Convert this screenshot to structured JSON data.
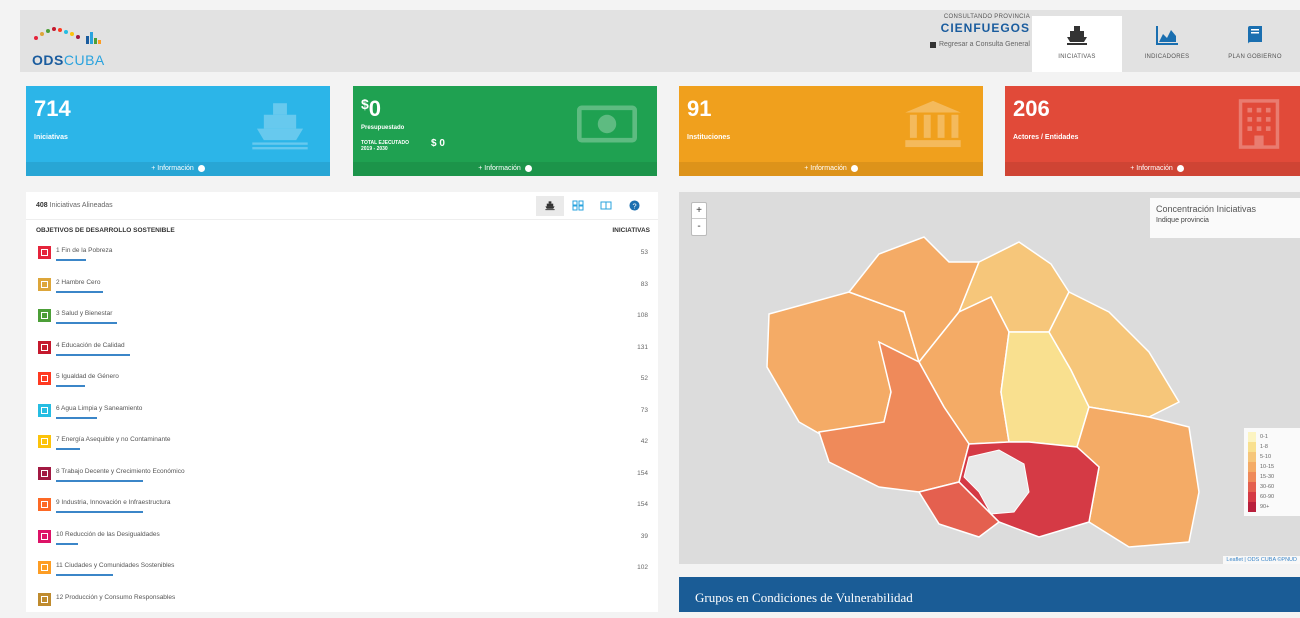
{
  "header": {
    "logo_ods": "ODS",
    "logo_cuba": "CUBA",
    "province_caption": "CONSULTANDO PROVINCIA",
    "province_name": "CIENFUEGOS",
    "province_link": "Regresar a Consulta General",
    "nav": [
      {
        "label": "INICIATIVAS",
        "icon": "ship-icon",
        "active": true
      },
      {
        "label": "INDICADORES",
        "icon": "area-chart-icon",
        "active": false
      },
      {
        "label": "PLAN GOBIERNO",
        "icon": "book-icon",
        "active": false
      }
    ]
  },
  "cards": [
    {
      "value": "714",
      "label": "Iniciativas",
      "more": "+ Información",
      "color": "#2cb5e8",
      "icon": "ship-icon"
    },
    {
      "value": "0",
      "currency": "$",
      "label": "Presupuestado",
      "sub_label_1": "TOTAL EJECUTADO",
      "sub_label_2": "2019 - 2030",
      "sub_value": "$ 0",
      "more": "+ Información",
      "color": "#1fa151",
      "icon": "money-icon"
    },
    {
      "value": "91",
      "label": "Instituciones",
      "more": "+ Información",
      "color": "#f0a01d",
      "icon": "institution-icon"
    },
    {
      "value": "206",
      "label": "Actores / Entidades",
      "more": "+ Información",
      "color": "#e14a39",
      "icon": "building-icon"
    }
  ],
  "ods_panel": {
    "count_number": "408",
    "count_text": "Iniciativas Alineadas",
    "col_objectives": "OBJETIVOS DE DESARROLLO SOSTENIBLE",
    "col_initiatives": "INICIATIVAS",
    "rows": [
      {
        "name": "1 Fin de la Pobreza",
        "value": "53",
        "color": "#e5243b"
      },
      {
        "name": "2 Hambre Cero",
        "value": "83",
        "color": "#dda63a"
      },
      {
        "name": "3 Salud y Bienestar",
        "value": "108",
        "color": "#4c9f38"
      },
      {
        "name": "4 Educación de Calidad",
        "value": "131",
        "color": "#c5192d"
      },
      {
        "name": "5 Igualdad de Género",
        "value": "52",
        "color": "#ff3a21"
      },
      {
        "name": "6 Agua Limpia y Saneamiento",
        "value": "73",
        "color": "#26bde2"
      },
      {
        "name": "7 Energía Asequible y no Contaminante",
        "value": "42",
        "color": "#fcc30b"
      },
      {
        "name": "8 Trabajo Decente y Crecimiento Económico",
        "value": "154",
        "color": "#a21942"
      },
      {
        "name": "9 Industria, Innovación e Infraestructura",
        "value": "154",
        "color": "#fd6925"
      },
      {
        "name": "10 Reducción de las Desigualdades",
        "value": "39",
        "color": "#dd1367"
      },
      {
        "name": "11 Ciudades y Comunidades Sostenibles",
        "value": "102",
        "color": "#fd9d24"
      },
      {
        "name": "12 Producción y Consumo Responsables",
        "value": "",
        "color": "#bf8b2e"
      }
    ]
  },
  "map": {
    "zoom_in": "+",
    "zoom_out": "-",
    "info_title": "Concentración Iniciativas",
    "info_sub": "Indique provincia",
    "legend": [
      {
        "label": "0-1",
        "color": "#fcf4c2"
      },
      {
        "label": "1-8",
        "color": "#f9e08f"
      },
      {
        "label": "5-10",
        "color": "#f6c67a"
      },
      {
        "label": "10-15",
        "color": "#f4ab66"
      },
      {
        "label": "15-30",
        "color": "#ef8a5a"
      },
      {
        "label": "30-60",
        "color": "#e4604f"
      },
      {
        "label": "60-90",
        "color": "#d53a45"
      },
      {
        "label": "90+",
        "color": "#b81f3c"
      }
    ],
    "attribution": "Leaflet | ODS CUBA ©",
    "attribution_link": "PNUD"
  },
  "vulnerability_title": "Grupos en Condiciones de Vulnerabilidad"
}
